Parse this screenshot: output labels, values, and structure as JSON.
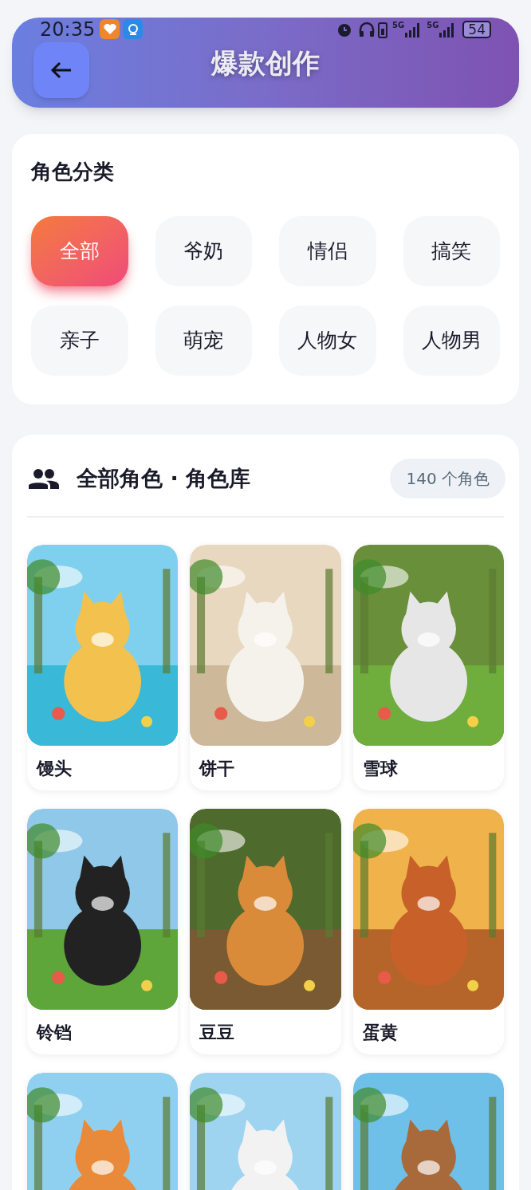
{
  "status_bar": {
    "time": "20:35",
    "network_labels": [
      "5G",
      "5G"
    ],
    "battery": "54"
  },
  "header": {
    "title": "爆款创作"
  },
  "category_panel": {
    "title": "角色分类",
    "categories": [
      {
        "label": "全部",
        "selected": true
      },
      {
        "label": "爷奶",
        "selected": false
      },
      {
        "label": "情侣",
        "selected": false
      },
      {
        "label": "搞笑",
        "selected": false
      },
      {
        "label": "亲子",
        "selected": false
      },
      {
        "label": "萌宠",
        "selected": false
      },
      {
        "label": "人物女",
        "selected": false
      },
      {
        "label": "人物男",
        "selected": false
      }
    ]
  },
  "library": {
    "title": "全部角色 · 角色库",
    "count": "140 个角色",
    "characters": [
      {
        "name": "馒头",
        "kind": "picture"
      },
      {
        "name": "饼干",
        "kind": "picture"
      },
      {
        "name": "雪球",
        "kind": "picture"
      },
      {
        "name": "铃铛",
        "kind": "picture"
      },
      {
        "name": "豆豆",
        "kind": "picture"
      },
      {
        "name": "蛋黄",
        "kind": "picture"
      },
      {
        "kind": "picture"
      },
      {
        "kind": "picture"
      },
      {
        "kind": "picture"
      }
    ]
  }
}
